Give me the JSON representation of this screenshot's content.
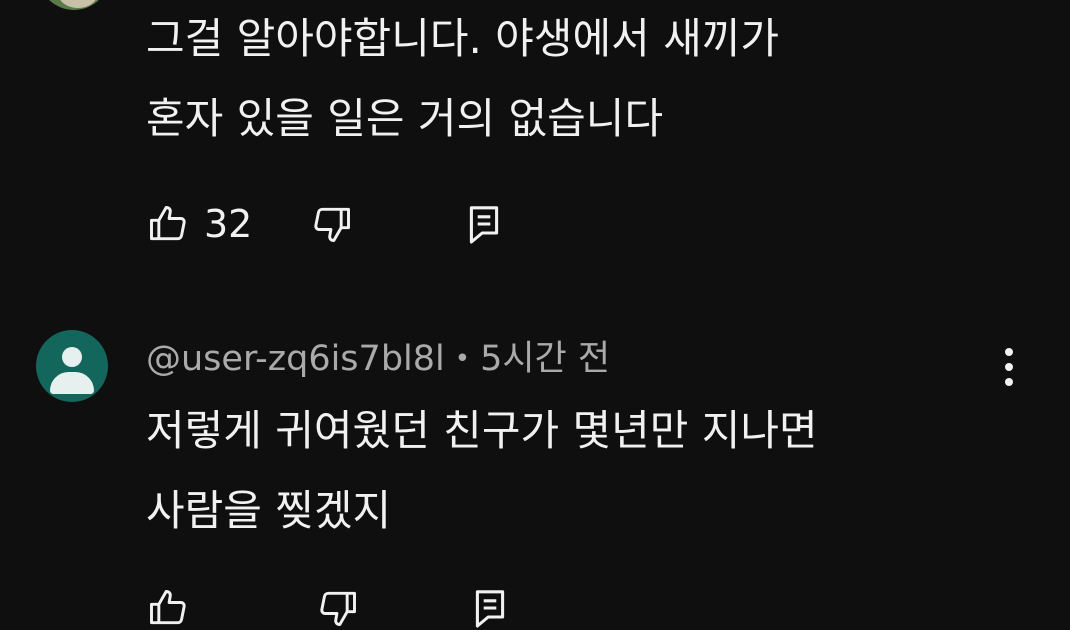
{
  "previous_comment": {
    "lines": [
      "그걸 알아야합니다. 야생에서 새끼가",
      "혼자 있을 일은 거의 없습니다"
    ],
    "like_count": "32",
    "icons": [
      "thumbs-up-icon",
      "thumbs-down-icon",
      "reply-icon"
    ]
  },
  "comment": {
    "author": "@user-zq6is7bl8l",
    "separator": "•",
    "time": "5시간 전",
    "lines": [
      "저렇게 귀여웠던 친구가 몇년만 지나면",
      "사람을 찢겠지"
    ],
    "icons": [
      "avatar-icon",
      "more-vert-icon",
      "thumbs-up-icon",
      "thumbs-down-icon",
      "reply-icon"
    ]
  },
  "colors": {
    "background": "#0f0f0f",
    "text": "#f1f1f1",
    "meta_text": "#aaaaaa",
    "avatar": "#13665b"
  }
}
